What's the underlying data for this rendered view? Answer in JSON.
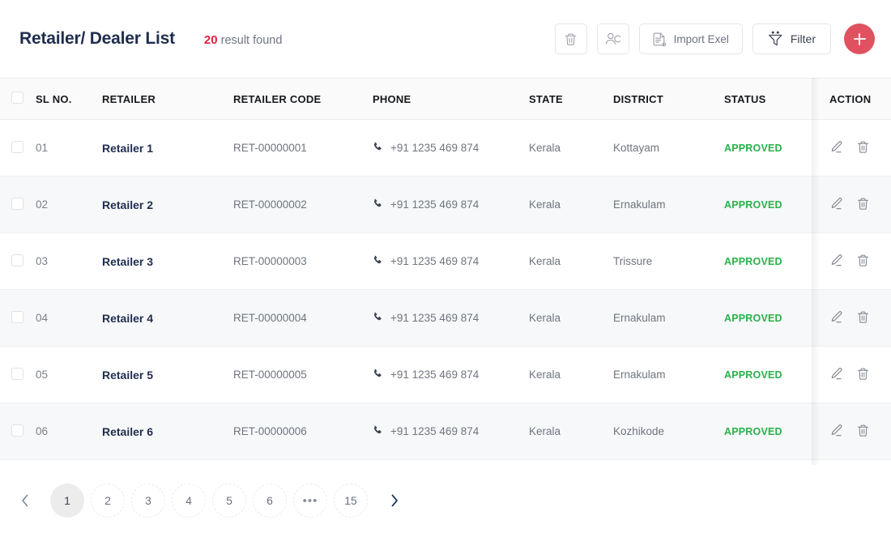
{
  "header": {
    "title": "Retailer/ Dealer List",
    "result_count": "20",
    "result_label": "result found",
    "accent_red": "#e3203f",
    "fab_color": "#e05260"
  },
  "toolbar": {
    "delete_icon": "trash-icon",
    "assign_user_icon": "user-check-icon",
    "import_label": "Import Exel",
    "import_icon": "document-icon",
    "filter_label": "Filter",
    "filter_icon": "funnel-icon",
    "add_label": "+"
  },
  "table": {
    "columns": [
      {
        "key": "check",
        "label": ""
      },
      {
        "key": "sl",
        "label": "SL NO."
      },
      {
        "key": "name",
        "label": "RETAILER"
      },
      {
        "key": "code",
        "label": "RETAILER  CODE"
      },
      {
        "key": "phone",
        "label": "PHONE"
      },
      {
        "key": "state",
        "label": "STATE"
      },
      {
        "key": "district",
        "label": "DISTRICT"
      },
      {
        "key": "status",
        "label": "STATUS"
      },
      {
        "key": "action",
        "label": "ACTION"
      }
    ],
    "status_color": "#29b24a",
    "rows": [
      {
        "sl": "01",
        "name": "Retailer 1",
        "code": "RET-00000001",
        "phone": "+91  1235 469 874",
        "state": "Kerala",
        "district": "Kottayam",
        "status": "APPROVED"
      },
      {
        "sl": "02",
        "name": "Retailer 2",
        "code": "RET-00000002",
        "phone": "+91  1235 469 874",
        "state": "Kerala",
        "district": "Ernakulam",
        "status": "APPROVED"
      },
      {
        "sl": "03",
        "name": "Retailer 3",
        "code": "RET-00000003",
        "phone": "+91  1235 469 874",
        "state": "Kerala",
        "district": "Trissure",
        "status": "APPROVED"
      },
      {
        "sl": "04",
        "name": "Retailer 4",
        "code": "RET-00000004",
        "phone": "+91  1235 469 874",
        "state": "Kerala",
        "district": "Ernakulam",
        "status": "APPROVED"
      },
      {
        "sl": "05",
        "name": "Retailer 5",
        "code": "RET-00000005",
        "phone": "+91  1235 469 874",
        "state": "Kerala",
        "district": "Ernakulam",
        "status": "APPROVED"
      },
      {
        "sl": "06",
        "name": "Retailer 6",
        "code": "RET-00000006",
        "phone": "+91  1235 469 874",
        "state": "Kerala",
        "district": "Kozhikode",
        "status": "APPROVED"
      }
    ],
    "row_actions": {
      "edit_icon": "pencil-icon",
      "delete_icon": "trash-icon"
    }
  },
  "pagination": {
    "prev_icon": "chevron-left-icon",
    "next_icon": "chevron-right-icon",
    "current": "1",
    "pages": [
      "1",
      "2",
      "3",
      "4",
      "5",
      "6",
      "•••",
      "15"
    ]
  }
}
